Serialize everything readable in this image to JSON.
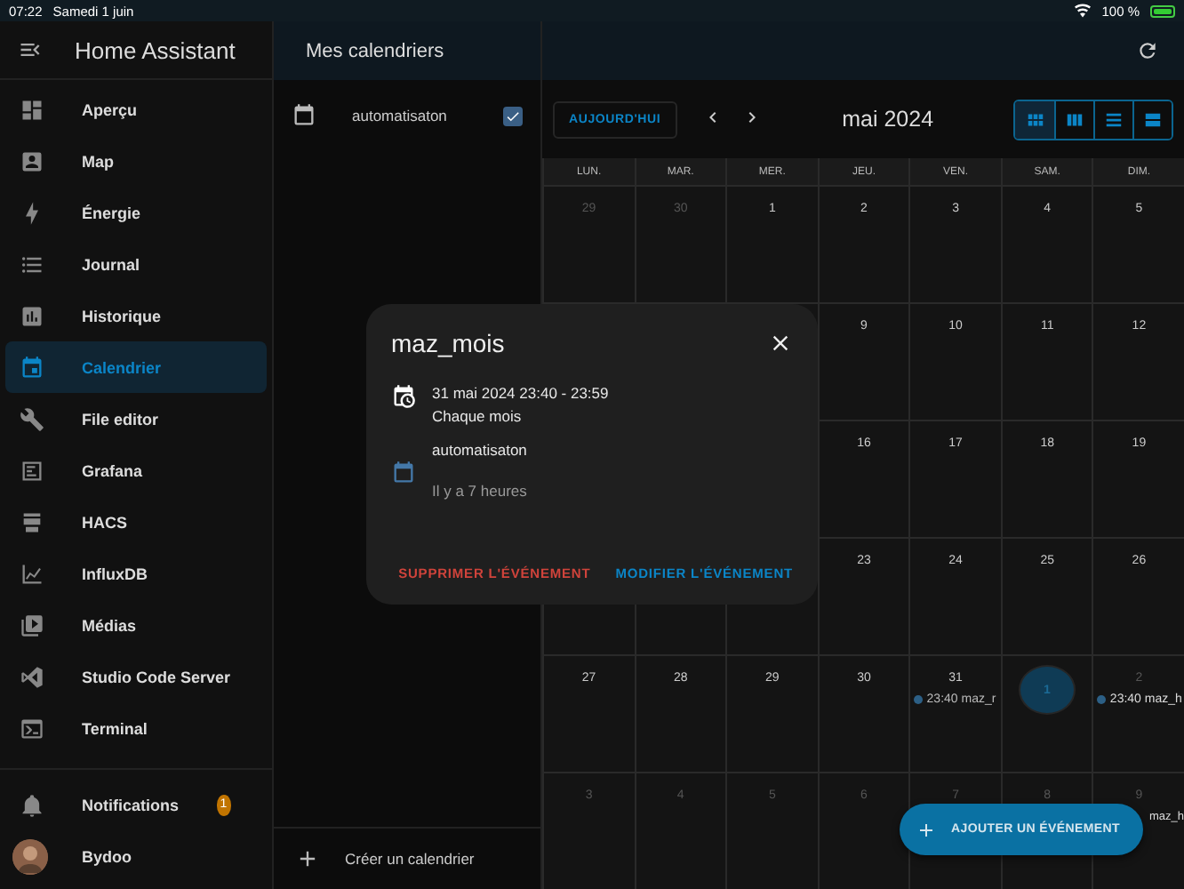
{
  "status_bar": {
    "time": "07:22",
    "date": "Samedi 1 juin",
    "battery": "100 %"
  },
  "sidebar": {
    "title": "Home Assistant",
    "items": [
      {
        "label": "Aperçu",
        "selected": false
      },
      {
        "label": "Map",
        "selected": false
      },
      {
        "label": "Énergie",
        "selected": false
      },
      {
        "label": "Journal",
        "selected": false
      },
      {
        "label": "Historique",
        "selected": false
      },
      {
        "label": "Calendrier",
        "selected": true
      },
      {
        "label": "File editor",
        "selected": false
      },
      {
        "label": "Grafana",
        "selected": false
      },
      {
        "label": "HACS",
        "selected": false
      },
      {
        "label": "InfluxDB",
        "selected": false
      },
      {
        "label": "Médias",
        "selected": false
      },
      {
        "label": "Studio Code Server",
        "selected": false
      },
      {
        "label": "Terminal",
        "selected": false
      }
    ],
    "notifications": {
      "label": "Notifications",
      "badge": "1"
    },
    "user": {
      "name": "Bydoo"
    }
  },
  "calendars_panel": {
    "title": "Mes calendriers",
    "calendars": [
      {
        "name": "automatisaton",
        "checked": true
      }
    ],
    "create_label": "Créer un calendrier"
  },
  "calendar": {
    "today_button": "AUJOURD'HUI",
    "month_title": "mai 2024",
    "views": [
      {
        "selected": true
      },
      {
        "selected": false
      },
      {
        "selected": false
      },
      {
        "selected": false
      }
    ],
    "weekdays": [
      "LUN.",
      "MAR.",
      "MER.",
      "JEU.",
      "VEN.",
      "SAM.",
      "DIM."
    ],
    "weeks": [
      [
        {
          "date": "29",
          "muted": true
        },
        {
          "date": "30",
          "muted": true
        },
        {
          "date": "1",
          "muted": false
        },
        {
          "date": "2",
          "muted": false
        },
        {
          "date": "3",
          "muted": false
        },
        {
          "date": "4",
          "muted": false
        },
        {
          "date": "5",
          "muted": false
        }
      ],
      [
        {
          "date": "9",
          "muted": false
        },
        {
          "date": "10",
          "muted": false
        },
        {
          "date": "11",
          "muted": false
        },
        {
          "date": "12",
          "muted": false
        }
      ],
      [
        {
          "date": "16",
          "muted": false
        },
        {
          "date": "17",
          "muted": false
        },
        {
          "date": "18",
          "muted": false
        },
        {
          "date": "19",
          "muted": false
        }
      ],
      [
        {
          "date": "23",
          "muted": false
        },
        {
          "date": "24",
          "muted": false
        },
        {
          "date": "25",
          "muted": false
        },
        {
          "date": "26",
          "muted": false
        }
      ],
      [
        {
          "date": "27",
          "muted": false
        },
        {
          "date": "28",
          "muted": false
        },
        {
          "date": "29",
          "muted": false
        },
        {
          "date": "30",
          "muted": false
        },
        {
          "date": "31",
          "muted": false,
          "events": [
            {
              "time": "23:40",
              "title": "maz_r"
            }
          ]
        },
        {
          "date": "1",
          "muted": false,
          "today": true
        },
        {
          "date": "2",
          "muted": true,
          "events": [
            {
              "time": "23:40",
              "title": "maz_h"
            }
          ]
        }
      ],
      [
        {
          "date": "3",
          "muted": true
        },
        {
          "date": "4",
          "muted": true
        },
        {
          "date": "5",
          "muted": true
        },
        {
          "date": "6",
          "muted": true
        },
        {
          "date": "7",
          "muted": true
        },
        {
          "date": "8",
          "muted": true
        },
        {
          "date": "9",
          "muted": true,
          "events": [
            {
              "title": "maz_h"
            }
          ]
        }
      ]
    ]
  },
  "dialog": {
    "title": "maz_mois",
    "when": "31 mai 2024 23:40 - 23:59",
    "repeat": "Chaque mois",
    "calendar": "automatisaton",
    "ago": "Il y a 7 heures",
    "delete_button": "SUPPRIMER L'ÉVÉNEMENT",
    "edit_button": "MODIFIER L'ÉVÉNEMENT"
  },
  "fab": {
    "label": "AJOUTER UN ÉVÉNEMENT"
  }
}
